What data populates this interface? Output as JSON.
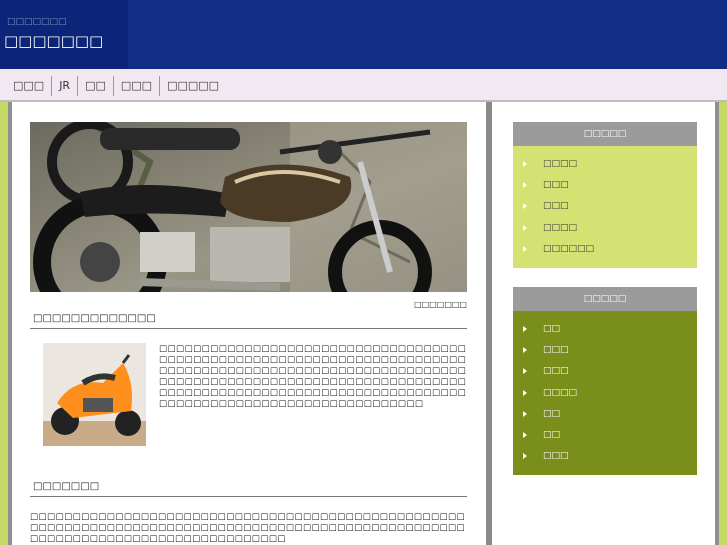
{
  "header": {
    "subtitle": "□□□□□□□",
    "title": "□□□□□□□"
  },
  "nav": {
    "items": [
      "□□□",
      "JR",
      "□□",
      "□□□",
      "□□□□□"
    ]
  },
  "hero": {
    "caption": "□□□□□□□"
  },
  "section1": {
    "heading": "□□□□□□□□□□□□□",
    "paragraph": "□□□□□□□□□□□□□□□□□□□□□□□□□□□□□□□□□□□□□□□□□□□□□□□□□□□□□□□□□□□□□□□□□□□□□□□□□□□□□□□□□□□□□□□□□□□□□□□□□□□□□□□□□□□□□□□□□□□□□□□□□□□□□□□□□□□□□□□□□□□□□□□□□□□□□□□□□□□□□□□□□□□□□□□□□□□□□□□□□□□□□□□□□□□□□□□□□□□□□□□□□□□□□□□□□□□"
  },
  "section2": {
    "heading": "□□□□□□□",
    "paragraph": "□□□□□□□□□□□□□□□□□□□□□□□□□□□□□□□□□□□□□□□□□□□□□□□□□□□□□□□□□□□□□□□□□□□□□□□□□□□□□□□□□□□□□□□□□□□□□□□□□□□□□□□□□□□□□□□□□□□□□□□□□□□□□□□□□□□□"
  },
  "sidebar1": {
    "title": "□□□□□",
    "items": [
      "□□□□",
      "□□□",
      "□□□",
      "□□□□",
      "□□□□□□"
    ]
  },
  "sidebar2": {
    "title": "□□□□□",
    "items": [
      "□□",
      "□□□",
      "□□□",
      "□□□□",
      "□□",
      "□□",
      "□□□"
    ]
  },
  "colors": {
    "header_bg": "#122d86",
    "accent_green": "#c5d966",
    "sidebar2_bg": "#7a8e1b"
  }
}
